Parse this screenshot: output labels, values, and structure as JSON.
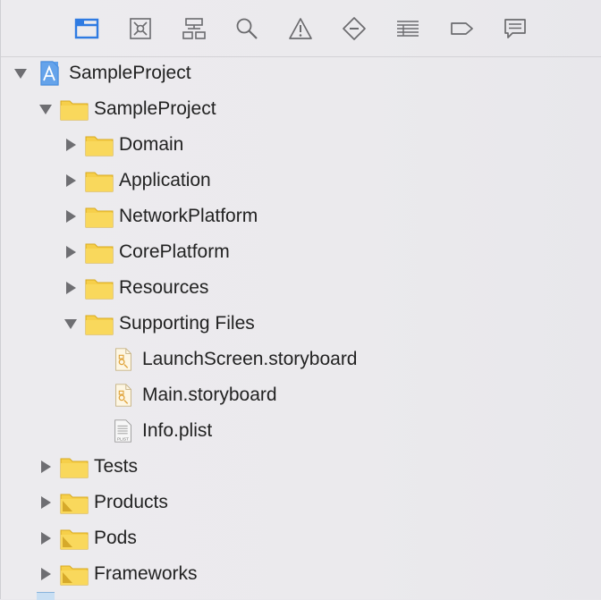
{
  "toolbar": {
    "items": [
      {
        "icon": "project-navigator-icon",
        "active": true
      },
      {
        "icon": "source-control-icon",
        "active": false
      },
      {
        "icon": "symbol-navigator-icon",
        "active": false
      },
      {
        "icon": "find-icon",
        "active": false
      },
      {
        "icon": "issue-warning-icon",
        "active": false
      },
      {
        "icon": "test-navigator-icon",
        "active": false
      },
      {
        "icon": "debug-navigator-icon",
        "active": false
      },
      {
        "icon": "breakpoint-icon",
        "active": false
      },
      {
        "icon": "report-icon",
        "active": false
      }
    ],
    "active_color": "#2f7be2",
    "inactive_color": "#6b6b6e"
  },
  "tree": {
    "items": [
      {
        "label": "SampleProject",
        "kind": "project",
        "expanded": true
      },
      {
        "label": "SampleProject",
        "kind": "folder",
        "expanded": true
      },
      {
        "label": "Domain",
        "kind": "folder",
        "expanded": false
      },
      {
        "label": "Application",
        "kind": "folder",
        "expanded": false
      },
      {
        "label": "NetworkPlatform",
        "kind": "folder",
        "expanded": false
      },
      {
        "label": "CorePlatform",
        "kind": "folder",
        "expanded": false
      },
      {
        "label": "Resources",
        "kind": "folder",
        "expanded": false
      },
      {
        "label": "Supporting Files",
        "kind": "folder",
        "expanded": true
      },
      {
        "label": "LaunchScreen.storyboard",
        "kind": "storyboard"
      },
      {
        "label": "Main.storyboard",
        "kind": "storyboard"
      },
      {
        "label": "Info.plist",
        "kind": "plist",
        "badge": "PLIST"
      },
      {
        "label": "Tests",
        "kind": "folder",
        "expanded": false
      },
      {
        "label": "Products",
        "kind": "folder-special",
        "expanded": false
      },
      {
        "label": "Pods",
        "kind": "folder-special",
        "expanded": false
      },
      {
        "label": "Frameworks",
        "kind": "folder-special",
        "expanded": false
      }
    ],
    "folder_color": "#f6cf4a",
    "disclosure_color": "#6e6e72"
  }
}
